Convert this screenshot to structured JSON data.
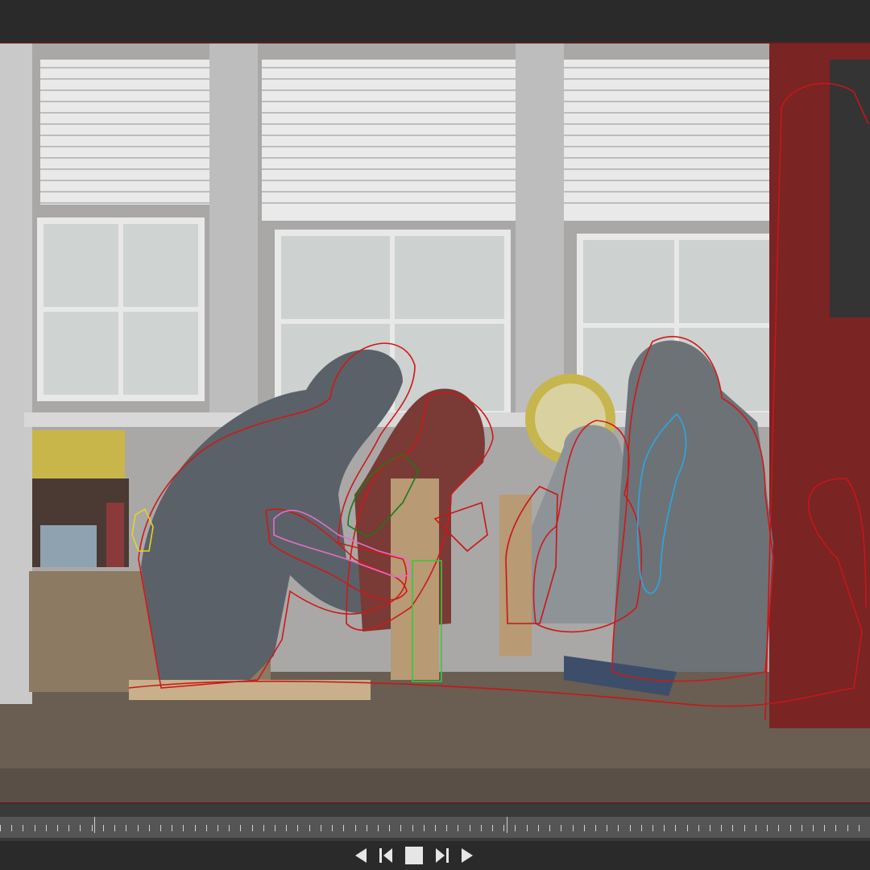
{
  "window": {
    "topbar_color": "#2a2a2a",
    "frame_border_color": "#5a2020"
  },
  "viewer": {
    "annotation_colors": {
      "person": "#d01818",
      "object": "#c81616",
      "hand": "#e6d22a",
      "sleeve": "#e070c8",
      "shirt": "#2aa8e0",
      "block": "#38c838",
      "cup": "#1a7a1a"
    }
  },
  "timeline": {
    "major_tick_fractions": [
      0.108,
      0.582
    ],
    "minor_tick_count": 76
  },
  "controls": {
    "buttons": [
      {
        "name": "prev-frame-button",
        "icon": "triangle-left-icon"
      },
      {
        "name": "step-back-button",
        "icon": "step-back-icon"
      },
      {
        "name": "stop-button",
        "icon": "stop-icon"
      },
      {
        "name": "step-forward-button",
        "icon": "step-forward-icon"
      },
      {
        "name": "next-frame-button",
        "icon": "triangle-right-icon"
      }
    ]
  }
}
